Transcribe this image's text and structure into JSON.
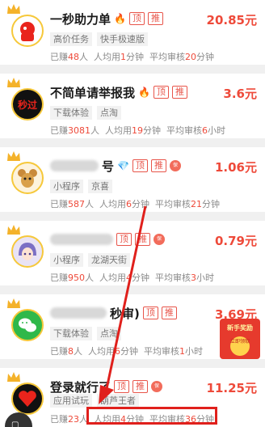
{
  "tasks": [
    {
      "title": "一秒助力单",
      "emoji": "🔥",
      "badges": [
        "顶",
        "推"
      ],
      "price": "20.85元",
      "tags": [
        "高价任务",
        "快手极速版"
      ],
      "earned_prefix": "已赚",
      "earned_count": "48",
      "earned_suffix": "人",
      "avg_prefix": "人均用",
      "avg_time": "1",
      "avg_suffix": "分钟",
      "review_prefix": "平均审核",
      "review_time": "20",
      "review_suffix": "分钟"
    },
    {
      "title": "不简单请举报我",
      "emoji": "🔥",
      "badges": [
        "顶",
        "推"
      ],
      "price": "3.6元",
      "tags": [
        "下载体验",
        "点淘"
      ],
      "earned_prefix": "已赚",
      "earned_count": "3081",
      "earned_suffix": "人",
      "avg_prefix": "人均用",
      "avg_time": "19",
      "avg_suffix": "分钟",
      "review_prefix": "平均审核",
      "review_time": "6",
      "review_suffix": "小时"
    },
    {
      "title": "号",
      "emoji": "💎",
      "badges": [
        "顶",
        "推"
      ],
      "badge_round": "保",
      "price": "1.06元",
      "tags": [
        "小程序",
        "京喜"
      ],
      "earned_prefix": "已赚",
      "earned_count": "587",
      "earned_suffix": "人",
      "avg_prefix": "人均用",
      "avg_time": "6",
      "avg_suffix": "分钟",
      "review_prefix": "平均审核",
      "review_time": "21",
      "review_suffix": "分钟"
    },
    {
      "title": "",
      "emoji": "",
      "badges": [
        "顶",
        "推"
      ],
      "badge_round": "保",
      "price": "0.79元",
      "tags": [
        "小程序",
        "龙湖天街"
      ],
      "earned_prefix": "已赚",
      "earned_count": "950",
      "earned_suffix": "人",
      "avg_prefix": "人均用",
      "avg_time": "4",
      "avg_suffix": "分钟",
      "review_prefix": "平均审核",
      "review_time": "3",
      "review_suffix": "小时"
    },
    {
      "title": "秒审)",
      "emoji": "",
      "badges": [
        "顶",
        "推"
      ],
      "price": "3.69元",
      "tags": [
        "下载体验",
        "点淘"
      ],
      "earned_prefix": "已赚",
      "earned_count": "8",
      "earned_suffix": "人",
      "avg_prefix": "人均用",
      "avg_time": "6",
      "avg_suffix": "分钟",
      "review_prefix": "平均审核",
      "review_time": "1",
      "review_suffix": "小时"
    },
    {
      "title": "登录就行了",
      "emoji": "",
      "badges": [
        "顶",
        "推"
      ],
      "badge_round": "保",
      "price": "11.25元",
      "tags": [
        "应用试玩",
        "葫芦王者"
      ],
      "earned_prefix": "已赚",
      "earned_count": "23",
      "earned_suffix": "人",
      "avg_prefix": "人均用",
      "avg_time": "4",
      "avg_suffix": "分钟",
      "review_prefix": "平均审核",
      "review_time": "36",
      "review_suffix": "分钟"
    }
  ],
  "avatar_text_2": "秒过",
  "promo": {
    "top": "新手奖励",
    "coin": "立即领取"
  },
  "colors": {
    "accent": "#ee4a3a",
    "highlight": "#e0201c"
  }
}
